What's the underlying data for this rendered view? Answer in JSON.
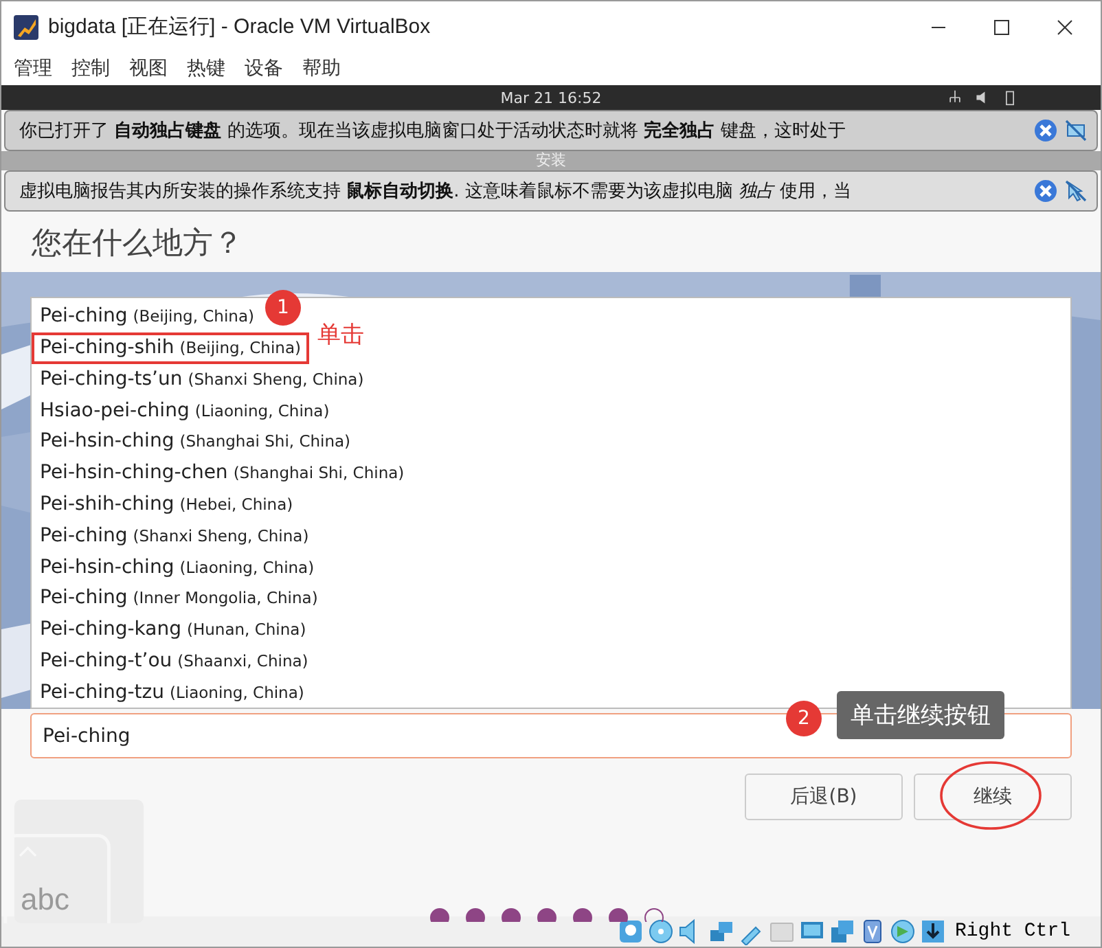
{
  "window": {
    "title": "bigdata [正在运行] - Oracle VM VirtualBox"
  },
  "menu": [
    "管理",
    "控制",
    "视图",
    "热键",
    "设备",
    "帮助"
  ],
  "vm_panel": {
    "clock": "Mar 21  16:52"
  },
  "banners": [
    {
      "text": "你已打开了 **自动独占键盘** 的选项。现在当该虚拟电脑窗口处于活动状态时就将 **完全独占** 键盘，这时处于"
    },
    {
      "text": "虚拟电脑报告其内所安装的操作系统支持 **鼠标自动切换**. 这意味着鼠标不需要为该虚拟电脑 *独占* 使用，当"
    }
  ],
  "installer": {
    "title": "安装",
    "heading": "您在什么地方？",
    "cities": [
      {
        "name": "Pei-ching",
        "region": "(Beijing, China)",
        "highlighted": false
      },
      {
        "name": "Pei-ching-shih",
        "region": "(Beijing, China)",
        "highlighted": true
      },
      {
        "name": "Pei-ching-ts’un",
        "region": "(Shanxi Sheng, China)",
        "highlighted": false
      },
      {
        "name": "Hsiao-pei-ching",
        "region": "(Liaoning, China)",
        "highlighted": false
      },
      {
        "name": "Pei-hsin-ching",
        "region": "(Shanghai Shi, China)",
        "highlighted": false
      },
      {
        "name": "Pei-hsin-ching-chen",
        "region": "(Shanghai Shi, China)",
        "highlighted": false
      },
      {
        "name": "Pei-shih-ching",
        "region": "(Hebei, China)",
        "highlighted": false
      },
      {
        "name": "Pei-ching",
        "region": "(Shanxi Sheng, China)",
        "highlighted": false
      },
      {
        "name": "Pei-hsin-ching",
        "region": "(Liaoning, China)",
        "highlighted": false
      },
      {
        "name": "Pei-ching",
        "region": "(Inner Mongolia, China)",
        "highlighted": false
      },
      {
        "name": "Pei-ching-kang",
        "region": "(Hunan, China)",
        "highlighted": false
      },
      {
        "name": "Pei-ching-t’ou",
        "region": "(Shaanxi, China)",
        "highlighted": false
      },
      {
        "name": "Pei-ching-tzu",
        "region": "(Liaoning, China)",
        "highlighted": false
      }
    ],
    "location_field": {
      "value": "Pei-ching"
    },
    "buttons": [
      {
        "label": "后退(B)",
        "circled": false
      },
      {
        "label": "继续",
        "circled": true
      }
    ],
    "keyboard_hint": "abc",
    "progress_dots": [
      {
        "done": true
      },
      {
        "done": true
      },
      {
        "done": true
      },
      {
        "done": true
      },
      {
        "done": true
      },
      {
        "done": true
      },
      {
        "done": false
      }
    ]
  },
  "annotations": [
    {
      "number": "1",
      "note": "单击"
    },
    {
      "number": "2",
      "note": "单击继续按钮"
    }
  ],
  "status_bar": {
    "host_key": "Right Ctrl"
  }
}
